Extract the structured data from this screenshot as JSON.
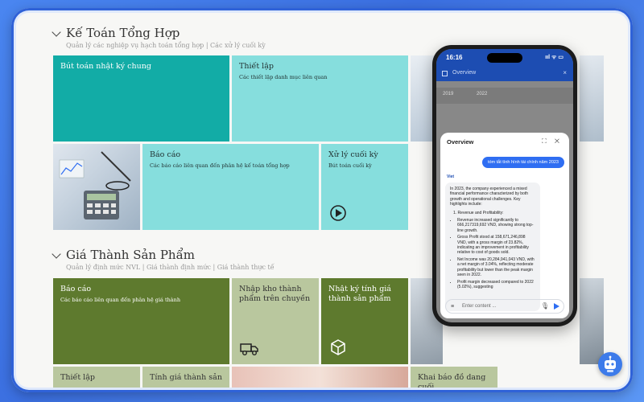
{
  "sections": {
    "accounting": {
      "title": "Kế Toán Tổng Hợp",
      "subtitle": "Quản lý các nghiệp vụ hạch toán tổng hợp | Các xử lý cuối kỳ",
      "tiles": [
        {
          "title": "Bút toán nhật ký chung",
          "subtitle": ""
        },
        {
          "title": "Thiết lập",
          "subtitle": "Các thiết lập danh mục liên quan"
        },
        {
          "title": "Báo cáo",
          "subtitle": "Các báo cáo liên quan đến phân hệ kế toán tổng hợp"
        },
        {
          "title": "Xử lý cuối kỳ",
          "subtitle": "Bút toán cuối kỳ"
        }
      ]
    },
    "costing": {
      "title": "Giá Thành Sản Phẩm",
      "subtitle": "Quản lý định mức NVL | Giá thành định mức | Giá thành thực tế",
      "tiles": [
        {
          "title": "Báo cáo",
          "subtitle": "Các báo cáo liên quan đến phân hệ giá thành"
        },
        {
          "title": "Nhập kho thành phẩm trên chuyền",
          "subtitle": ""
        },
        {
          "title": "Nhật ký tính giá thành sản phẩm",
          "subtitle": ""
        },
        {
          "title": "Thiết lập",
          "subtitle": ""
        },
        {
          "title": "Tính giá thành sản",
          "subtitle": ""
        },
        {
          "title": "Khai báo đồ dang cuối",
          "subtitle": ""
        }
      ]
    }
  },
  "phone": {
    "time": "16:16",
    "status_right": "ııl ᯤ ▭",
    "appbar_title": "Overview",
    "years": [
      "2019",
      "2022"
    ],
    "chat": {
      "title": "Overview",
      "controls": "⛶ ✕",
      "user_message": "tóm tắt tình hình tài chính năm 2023",
      "brand": "Viet",
      "intro": "In 2023, the company experienced a mixed financial performance characterized by both growth and operational challenges. Key highlights include:",
      "point_heading": "1. Revenue and Profitability:",
      "bullets": [
        "Revenue increased significantly to 666,217319,692 VND, showing strong top-line growth.",
        "Gross Profit stood at 158,671,246,898 VND, with a gross margin of 23.82%, indicating an improvement in profitability relative to cost of goods sold.",
        "Net Income was 20,284,941,043 VND, with a net margin of 3.04%, reflecting moderate profitability but lower than the peak margin seen in 2022.",
        "Profit margin decreased compared to 2022 (5.02%), suggesting"
      ],
      "input_placeholder": "Enter content ..."
    }
  },
  "colors": {
    "teal": "#12aca6",
    "cyan": "#86dedd",
    "olive": "#5e7a2e",
    "sage": "#b9c79e",
    "brand_blue": "#1d4db2"
  }
}
